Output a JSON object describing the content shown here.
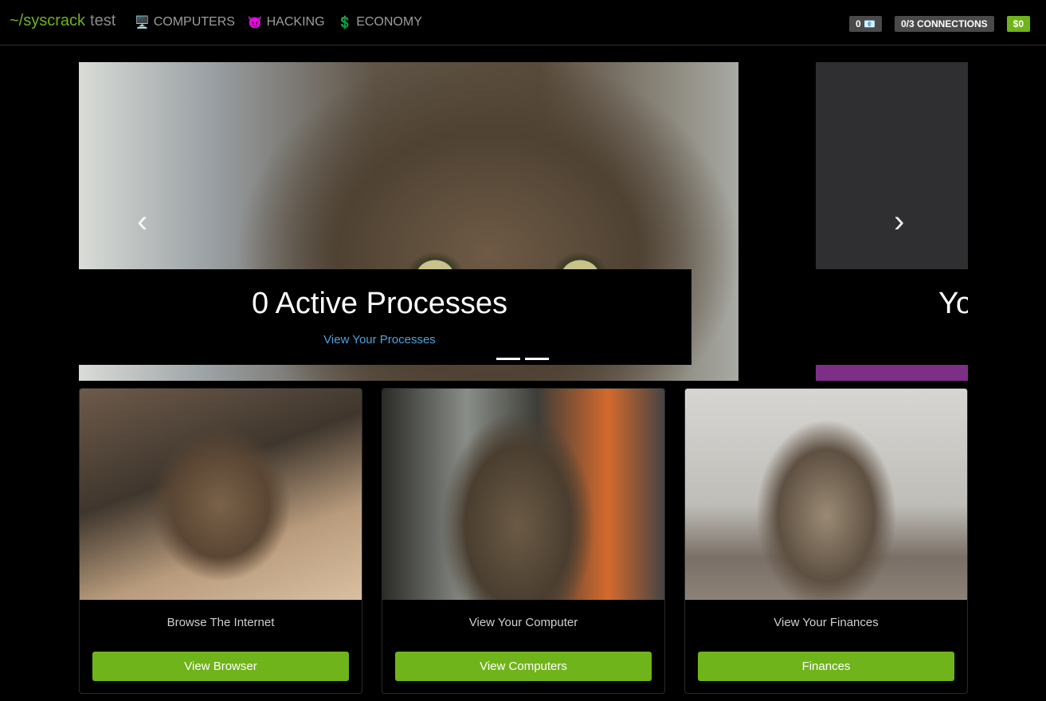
{
  "brand": {
    "name": "~/syscrack",
    "sub": "test"
  },
  "nav": [
    {
      "icon": "🖥️",
      "label": "COMPUTERS"
    },
    {
      "icon": "😈",
      "label": "HACKING"
    },
    {
      "icon": "💲",
      "label": "ECONOMY"
    }
  ],
  "badges": {
    "mail": "0 📧",
    "connections": "0/3 CONNECTIONS",
    "money": "$0"
  },
  "carousel": {
    "title": "0 Active Processes",
    "link": "View Your Processes",
    "next_title_partial": "Yo",
    "prev_arrow": "‹",
    "next_arrow": "›",
    "indicator_count": 2
  },
  "cards": [
    {
      "title": "Browse The Internet",
      "button": "View Browser"
    },
    {
      "title": "View Your Computer",
      "button": "View Computers"
    },
    {
      "title": "View Your Finances",
      "button": "Finances"
    }
  ]
}
